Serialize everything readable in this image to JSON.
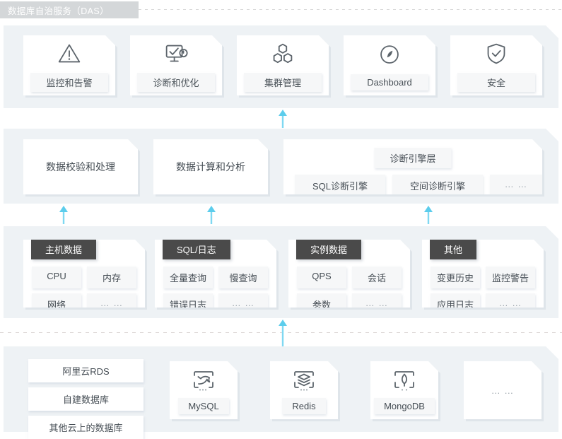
{
  "title": {
    "text": "数据库自治服务（DAS）"
  },
  "colors": {
    "band_bg": "#eef2f5",
    "card_bg": "#ffffff",
    "tile_bg": "#f6f7f8",
    "group_header_bg": "#4a4a4a",
    "arrow": "#6fd3ef",
    "title_bg": "#d4d7d9",
    "text": "#454d54",
    "muted": "#9aa3ab"
  },
  "apps": {
    "items": [
      {
        "label": "监控和告警",
        "icon": "warning-triangle-icon"
      },
      {
        "label": "诊断和优化",
        "icon": "monitor-diagnose-icon"
      },
      {
        "label": "集群管理",
        "icon": "cluster-hexagons-icon"
      },
      {
        "label": "Dashboard",
        "icon": "gauge-icon"
      },
      {
        "label": "安全",
        "icon": "shield-check-icon"
      }
    ]
  },
  "compute": {
    "cards": [
      {
        "label": "数据校验和处理"
      },
      {
        "label": "数据计算和分析"
      }
    ],
    "engine": {
      "header": "诊断引擎层",
      "chips": [
        "SQL诊断引擎",
        "空间诊断引擎",
        "… …"
      ]
    }
  },
  "sources": {
    "groups": [
      {
        "header": "主机数据",
        "tiles": [
          "CPU",
          "内存",
          "网络",
          "… …"
        ]
      },
      {
        "header": "SQL/日志",
        "tiles": [
          "全量查询",
          "慢查询",
          "错误日志",
          "… …"
        ]
      },
      {
        "header": "实例数据",
        "tiles": [
          "QPS",
          "会话",
          "参数",
          "… …"
        ]
      },
      {
        "header": "其他",
        "tiles": [
          "变更历史",
          "监控警告",
          "应用日志",
          "… …"
        ]
      }
    ]
  },
  "targets": {
    "stack": [
      "阿里云RDS",
      "自建数据库",
      "其他云上的数据库"
    ],
    "databases": [
      {
        "label": "MySQL",
        "icon": "mysql-dolphin-icon"
      },
      {
        "label": "Redis",
        "icon": "redis-layers-icon"
      },
      {
        "label": "MongoDB",
        "icon": "mongodb-leaf-icon"
      }
    ],
    "more": "… …"
  }
}
